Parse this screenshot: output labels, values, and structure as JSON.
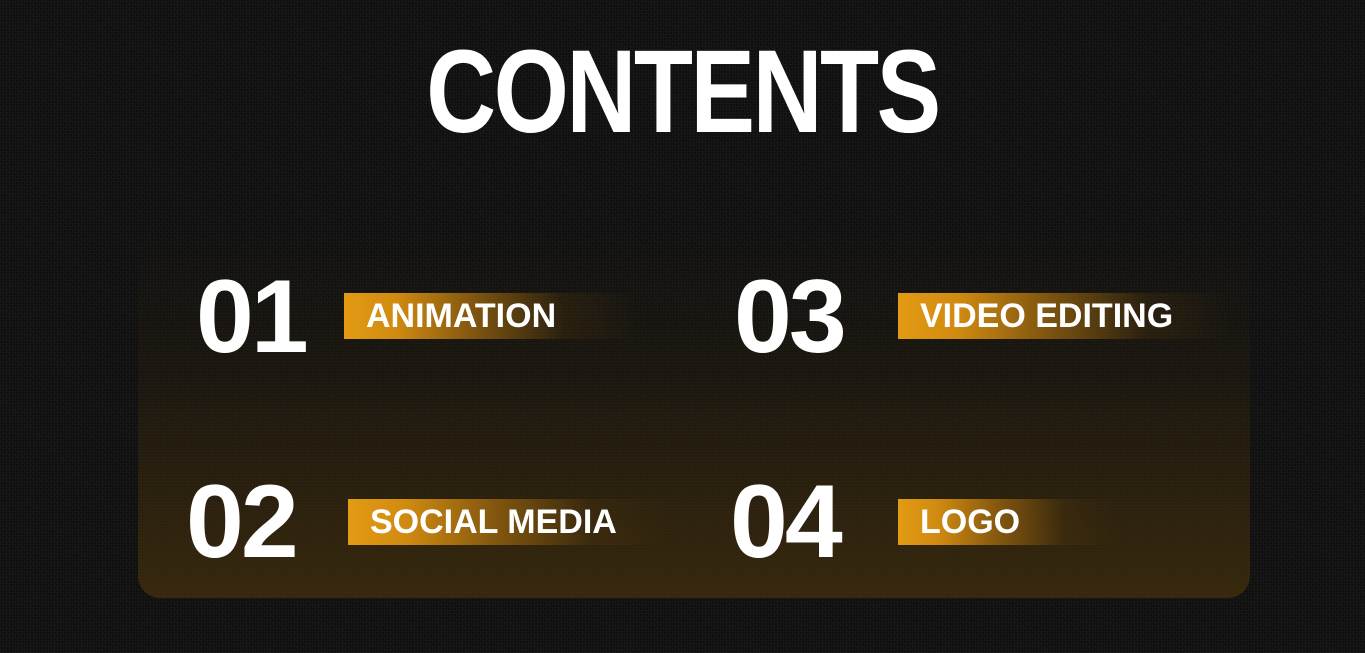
{
  "title": "CONTENTS",
  "items": [
    {
      "number": "01",
      "label": "ANIMATION"
    },
    {
      "number": "02",
      "label": "SOCIAL MEDIA"
    },
    {
      "number": "03",
      "label": "VIDEO EDITING"
    },
    {
      "number": "04",
      "label": "LOGO"
    }
  ],
  "colors": {
    "background": "#111111",
    "accent": "#e39b14",
    "text": "#ffffff"
  }
}
